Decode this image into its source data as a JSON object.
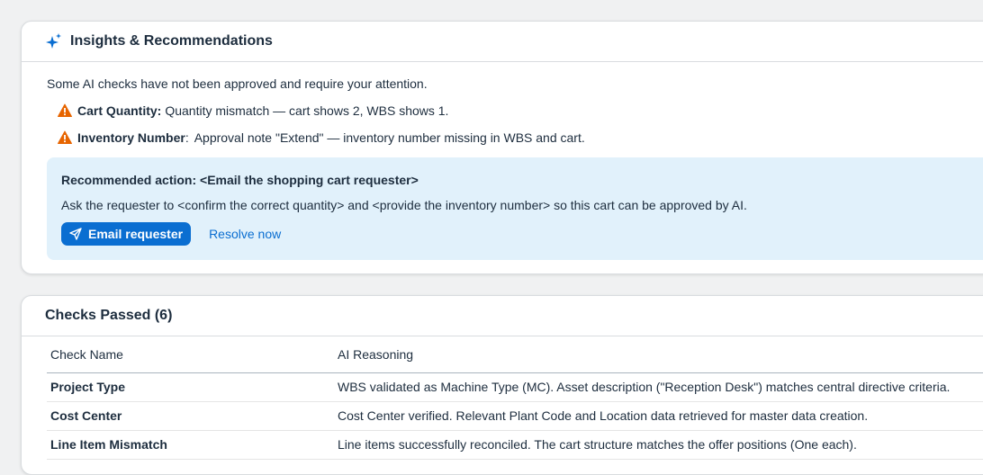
{
  "insights": {
    "title": "Insights & Recommendations",
    "intro": "Some AI checks have not been approved and require your attention.",
    "issues": [
      {
        "label": "Cart Quantity:",
        "text": "Quantity mismatch — cart shows 2, WBS shows 1."
      },
      {
        "label": "Inventory Number",
        "separator": ":",
        "text": "Approval note \"Extend\" — inventory number missing in WBS and cart."
      }
    ],
    "recommendation": {
      "title": "Recommended action: <Email the shopping cart requester>",
      "text": "Ask the requester to <confirm the correct quantity> and <provide the inventory number> so this cart can be approved by AI.",
      "primary_label": "Email requester",
      "secondary_label": "Resolve now"
    }
  },
  "checks": {
    "title": "Checks Passed (6)",
    "columns": [
      "Check Name",
      "AI Reasoning"
    ],
    "rows": [
      {
        "name": "Project Type",
        "reasoning": "WBS validated as Machine Type (MC). Asset description (\"Reception Desk\") matches central directive criteria."
      },
      {
        "name": "Cost Center",
        "reasoning": "Cost Center verified. Relevant Plant Code and Location data retrieved for master data creation."
      },
      {
        "name": "Line Item Mismatch",
        "reasoning": "Line items successfully reconciled. The cart structure matches the offer positions (One each)."
      }
    ]
  },
  "colors": {
    "accent": "#0a6ed1",
    "warning": "#e76500",
    "recommendation_bg": "#e1f1fb"
  },
  "icons": {
    "insights": "sparkle-icon",
    "issue": "warning-triangle-icon",
    "email": "send-icon"
  }
}
